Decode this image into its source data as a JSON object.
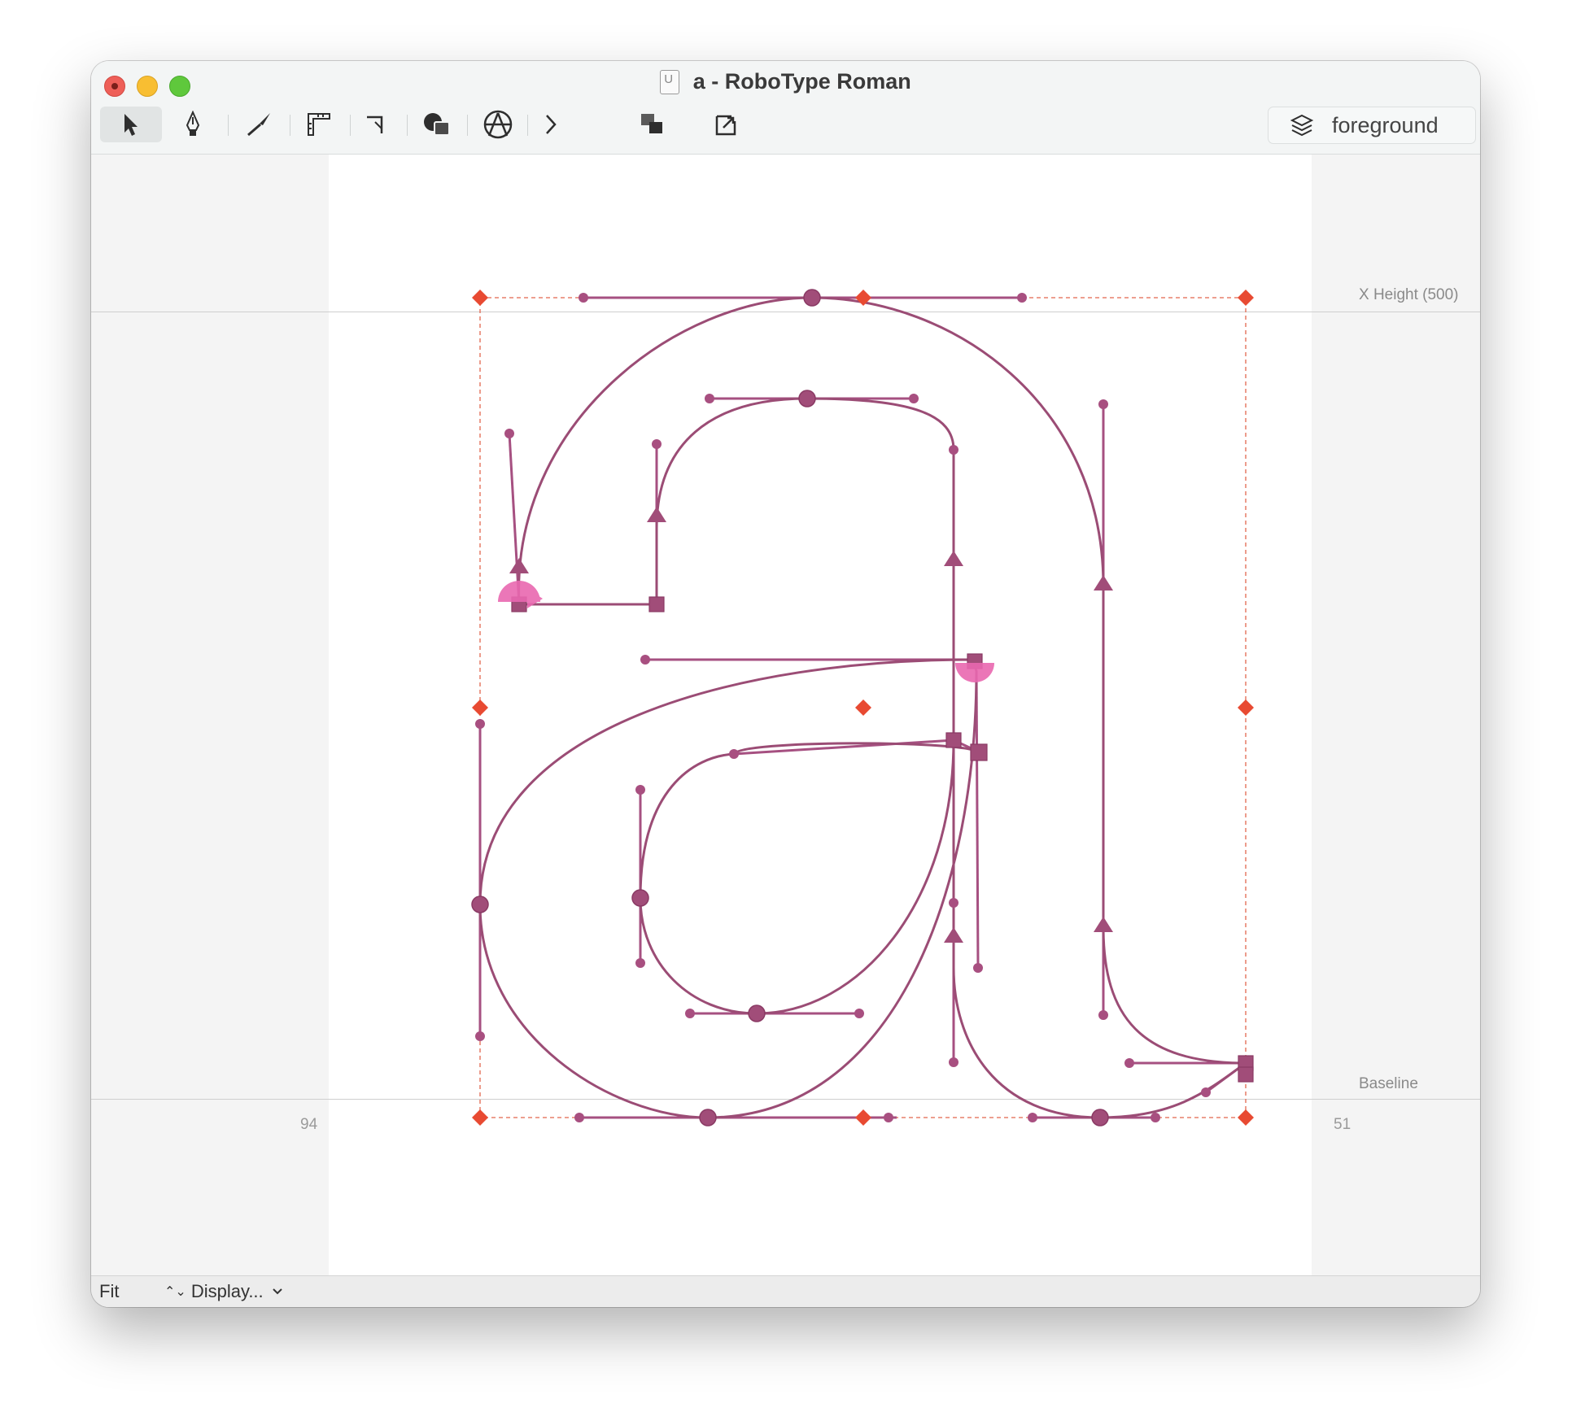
{
  "window": {
    "title": "a - RoboType Roman",
    "document_icon": "ufo-document-icon"
  },
  "toolbar": {
    "tools": [
      {
        "name": "select-tool",
        "icon": "arrow-pointer-icon",
        "active": true
      },
      {
        "name": "pen-tool",
        "icon": "pen-nib-icon"
      },
      {
        "name": "knife-tool",
        "icon": "knife-icon"
      },
      {
        "name": "measure-tool",
        "icon": "ruler-icon"
      },
      {
        "name": "corner-tool",
        "icon": "corner-icon"
      },
      {
        "name": "shapes-tool",
        "icon": "shapes-icon"
      },
      {
        "name": "anchor-tool",
        "icon": "compass-anchor-icon"
      },
      {
        "name": "more-tools",
        "icon": "chevron-right-icon"
      },
      {
        "name": "layer-order",
        "icon": "overlap-squares-icon"
      },
      {
        "name": "export-tool",
        "icon": "square-arrow-icon"
      }
    ],
    "layer": {
      "label": "foreground",
      "icon": "layers-icon"
    }
  },
  "guides": {
    "x_height_label": "X Height (500)",
    "baseline_label": "Baseline"
  },
  "sidebearings": {
    "left": "94",
    "right": "51"
  },
  "statusbar": {
    "zoom": "Fit",
    "display_label": "Display...",
    "display_arrows": "⌃⌄"
  },
  "colors": {
    "contour": "#9b4c75",
    "point": "#a14d79",
    "start_point": "#e968b0",
    "selection": "#e84a32",
    "bounds": "#e2664e"
  }
}
